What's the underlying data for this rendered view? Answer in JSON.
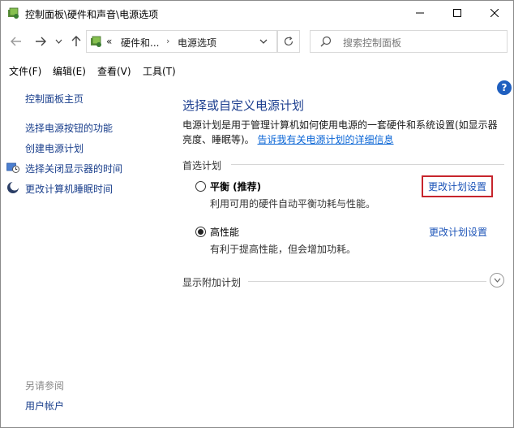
{
  "window": {
    "title": "控制面板\\硬件和声音\\电源选项"
  },
  "nav": {
    "address_prefix": "«",
    "address_segments": [
      "硬件和...",
      "电源选项"
    ],
    "search_placeholder": "搜索控制面板"
  },
  "menu": {
    "items": [
      "文件(F)",
      "编辑(E)",
      "查看(V)",
      "工具(T)"
    ]
  },
  "sidebar": {
    "home": "控制面板主页",
    "links": [
      "选择电源按钮的功能",
      "创建电源计划",
      "选择关闭显示器的时间",
      "更改计算机睡眠时间"
    ],
    "see_also_label": "另请参阅",
    "see_also_links": [
      "用户帐户"
    ]
  },
  "main": {
    "title": "选择或自定义电源计划",
    "description": "电源计划是用于管理计算机如何使用电源的一套硬件和系统设置(如显示器亮度、睡眠等)。",
    "description_link": "告诉我有关电源计划的详细信息",
    "preferred_label": "首选计划",
    "plans": [
      {
        "name": "平衡 (推荐)",
        "description": "利用可用的硬件自动平衡功耗与性能。",
        "link": "更改计划设置",
        "selected": false
      },
      {
        "name": "高性能",
        "description": "有利于提高性能，但会增加功耗。",
        "link": "更改计划设置",
        "selected": true
      }
    ],
    "additional_label": "显示附加计划"
  },
  "colors": {
    "link": "#1c54b8",
    "title": "#1c3e8f",
    "highlight_border": "#c7252c"
  }
}
